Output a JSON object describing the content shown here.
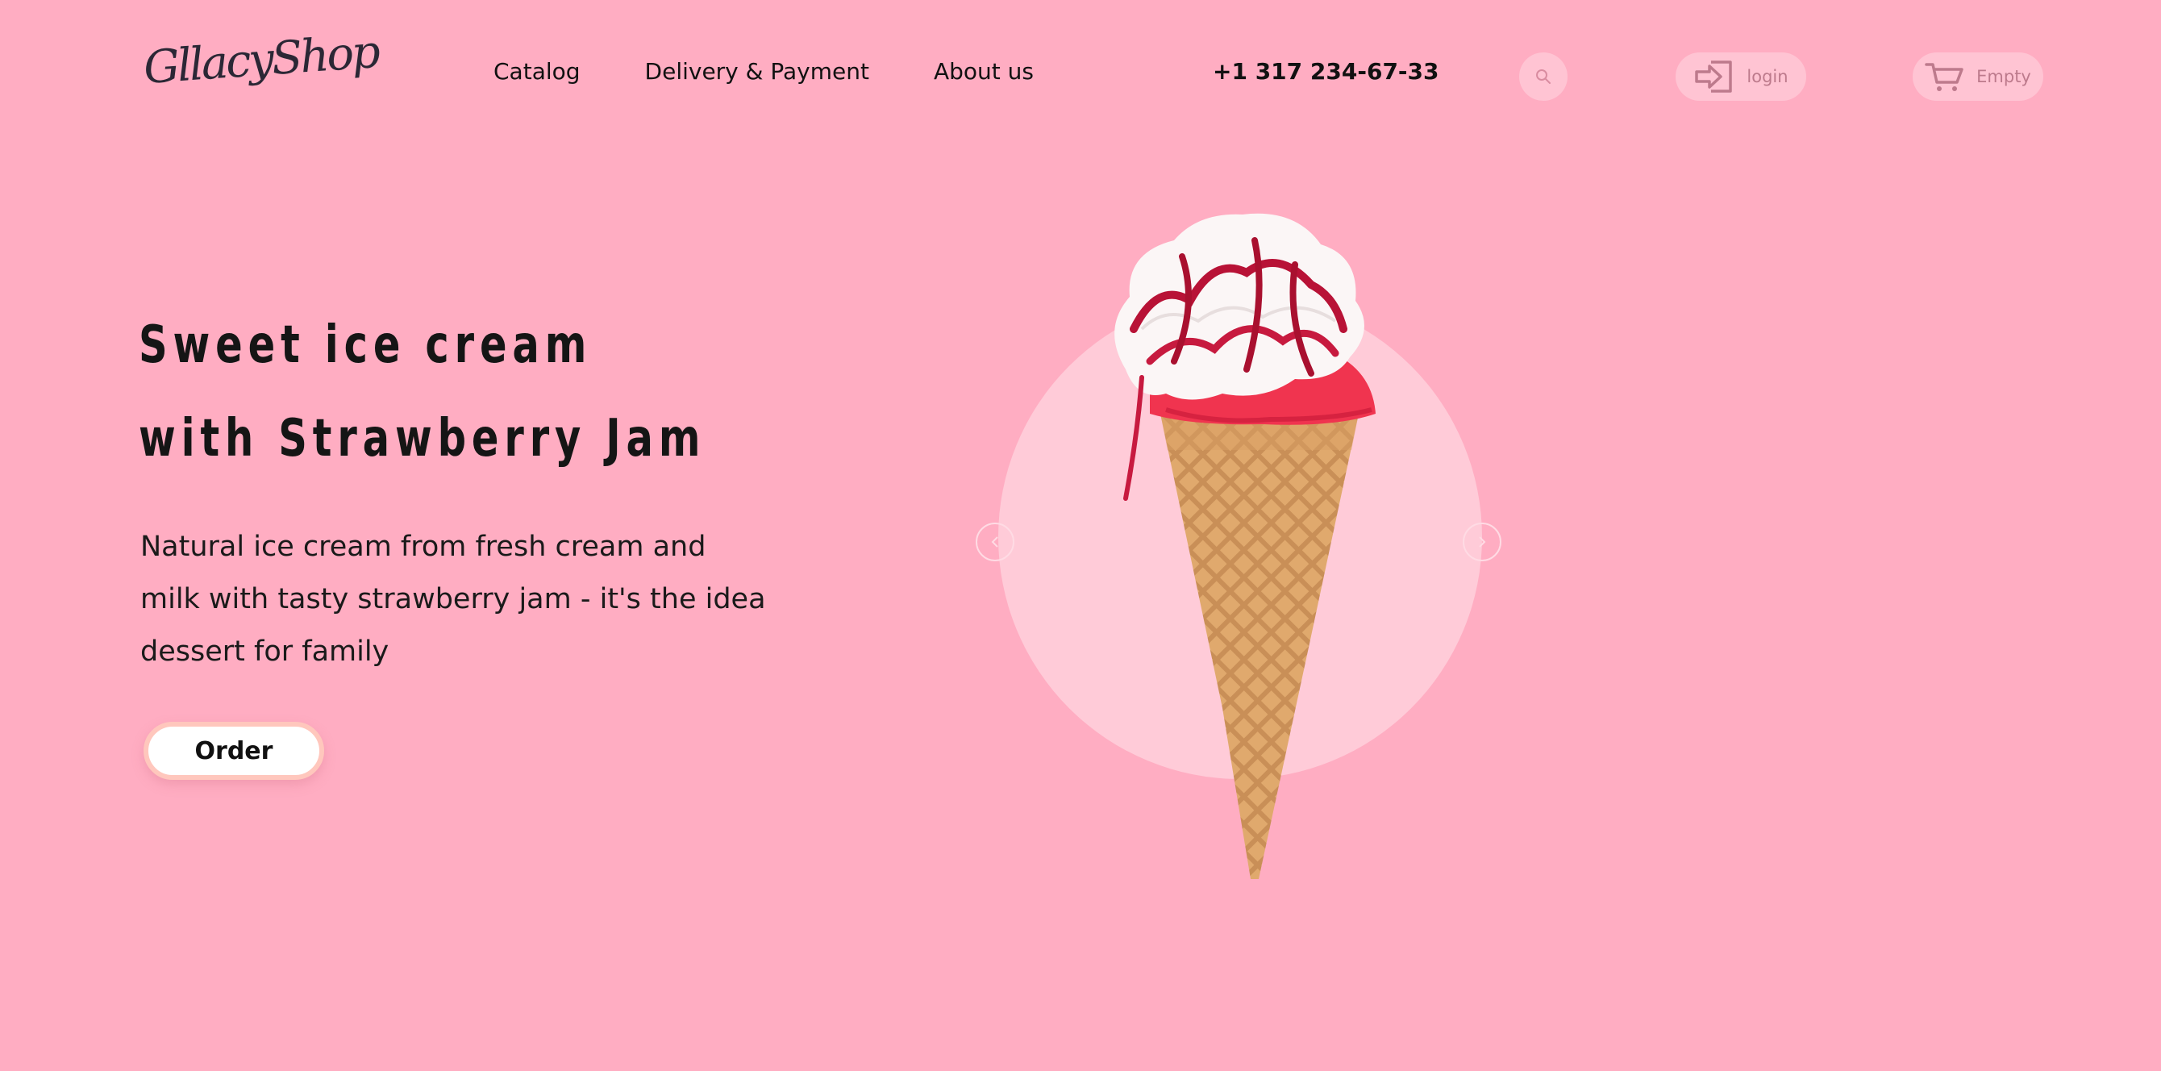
{
  "header": {
    "logo_text": "GllacyShop",
    "nav": [
      {
        "label": "Catalog"
      },
      {
        "label": "Delivery & Payment"
      },
      {
        "label": "About us"
      }
    ],
    "phone": "+1 317 234-67-33",
    "login_label": "login",
    "cart_label": "Empty",
    "icons": [
      "search-icon",
      "login-icon",
      "cart-icon"
    ]
  },
  "hero": {
    "title_line1": "Sweet ice cream",
    "title_line2": "with Strawberry Jam",
    "description": "Natural ice cream from fresh cream and milk with tasty strawberry jam - it's the idea dessert for family",
    "order_label": "Order"
  },
  "slider": {
    "prev_icon": "chevron-left-icon",
    "next_icon": "chevron-right-icon",
    "image": "strawberry-ice-cream-cone"
  },
  "colors": {
    "background": "#ffadc2",
    "circle": "#ffcbd8",
    "button_bg": "#ffc4d3",
    "button_text": "#bd7a8c",
    "order_border": "#ffc7bd"
  }
}
